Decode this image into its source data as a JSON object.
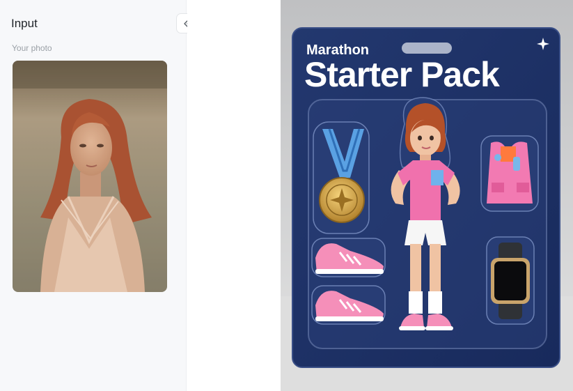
{
  "input_panel": {
    "title": "Input",
    "photo_label": "Your photo",
    "collapse_icon": "double-chevron-left-icon"
  },
  "result": {
    "package_subtitle": "Marathon",
    "package_title": "Starter Pack",
    "accessories": [
      "medal",
      "running-vest",
      "sneaker",
      "sneaker",
      "smartwatch"
    ]
  },
  "colors": {
    "panel_bg": "#f7f8fa",
    "package_navy": "#1b2e66",
    "shirt_pink": "#f071ad",
    "text_dark": "#1f2328",
    "text_muted": "#9aa0a6"
  }
}
